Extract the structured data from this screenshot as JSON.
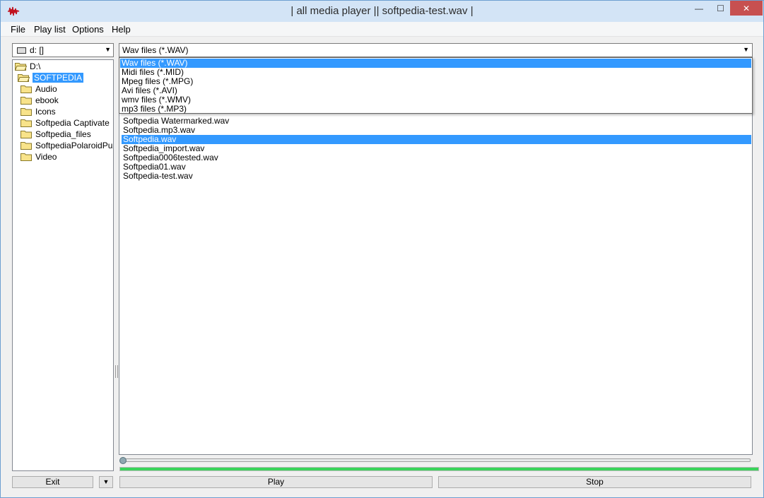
{
  "window": {
    "title": "| all media player || softpedia-test.wav |",
    "min_glyph": "—",
    "max_glyph": "☐",
    "close_glyph": "✕"
  },
  "menu": [
    "File",
    "Play list",
    "Options",
    "Help"
  ],
  "drive": {
    "label": "d: []",
    "arrow": "▼"
  },
  "tree": {
    "items": [
      {
        "label": "D:\\",
        "icon": "folder-open-icon",
        "selected": false
      },
      {
        "label": "SOFTPEDIA",
        "icon": "folder-open-icon",
        "selected": true
      },
      {
        "label": "Audio",
        "icon": "folder-icon",
        "selected": false
      },
      {
        "label": "ebook",
        "icon": "folder-icon",
        "selected": false
      },
      {
        "label": "Icons",
        "icon": "folder-icon",
        "selected": false
      },
      {
        "label": "Softpedia Captivate",
        "icon": "folder-icon",
        "selected": false
      },
      {
        "label": "Softpedia_files",
        "icon": "folder-icon",
        "selected": false
      },
      {
        "label": "SoftpediaPolaroidPuzzle",
        "icon": "folder-icon",
        "selected": false
      },
      {
        "label": "Video",
        "icon": "folder-icon",
        "selected": false
      }
    ]
  },
  "filter": {
    "value": "Wav files (*.WAV)",
    "arrow": "▼",
    "options": [
      {
        "label": "Wav files (*.WAV)",
        "selected": true
      },
      {
        "label": "Midi files (*.MID)",
        "selected": false
      },
      {
        "label": "Mpeg files (*.MPG)",
        "selected": false
      },
      {
        "label": "Avi files (*.AVI)",
        "selected": false
      },
      {
        "label": "wmv files (*.WMV)",
        "selected": false
      },
      {
        "label": "mp3 files (*.MP3)",
        "selected": false
      }
    ]
  },
  "files": [
    {
      "name": "Softpedia Watermarked.wav",
      "selected": false
    },
    {
      "name": "Softpedia.mp3.wav",
      "selected": false
    },
    {
      "name": "Softpedia.wav",
      "selected": true
    },
    {
      "name": "Softpedia_import.wav",
      "selected": false
    },
    {
      "name": "Softpedia0006tested.wav",
      "selected": false
    },
    {
      "name": "Softpedia01.wav",
      "selected": false
    },
    {
      "name": "Softpedia-test.wav",
      "selected": false
    }
  ],
  "playback": {
    "seek_position": 0,
    "progress_fraction": 1.0
  },
  "buttons": {
    "exit": "Exit",
    "exit_menu": "▼",
    "play": "Play",
    "stop": "Stop"
  },
  "colors": {
    "selection": "#3399ff",
    "progress": "#3ad45a",
    "close": "#c75050"
  }
}
